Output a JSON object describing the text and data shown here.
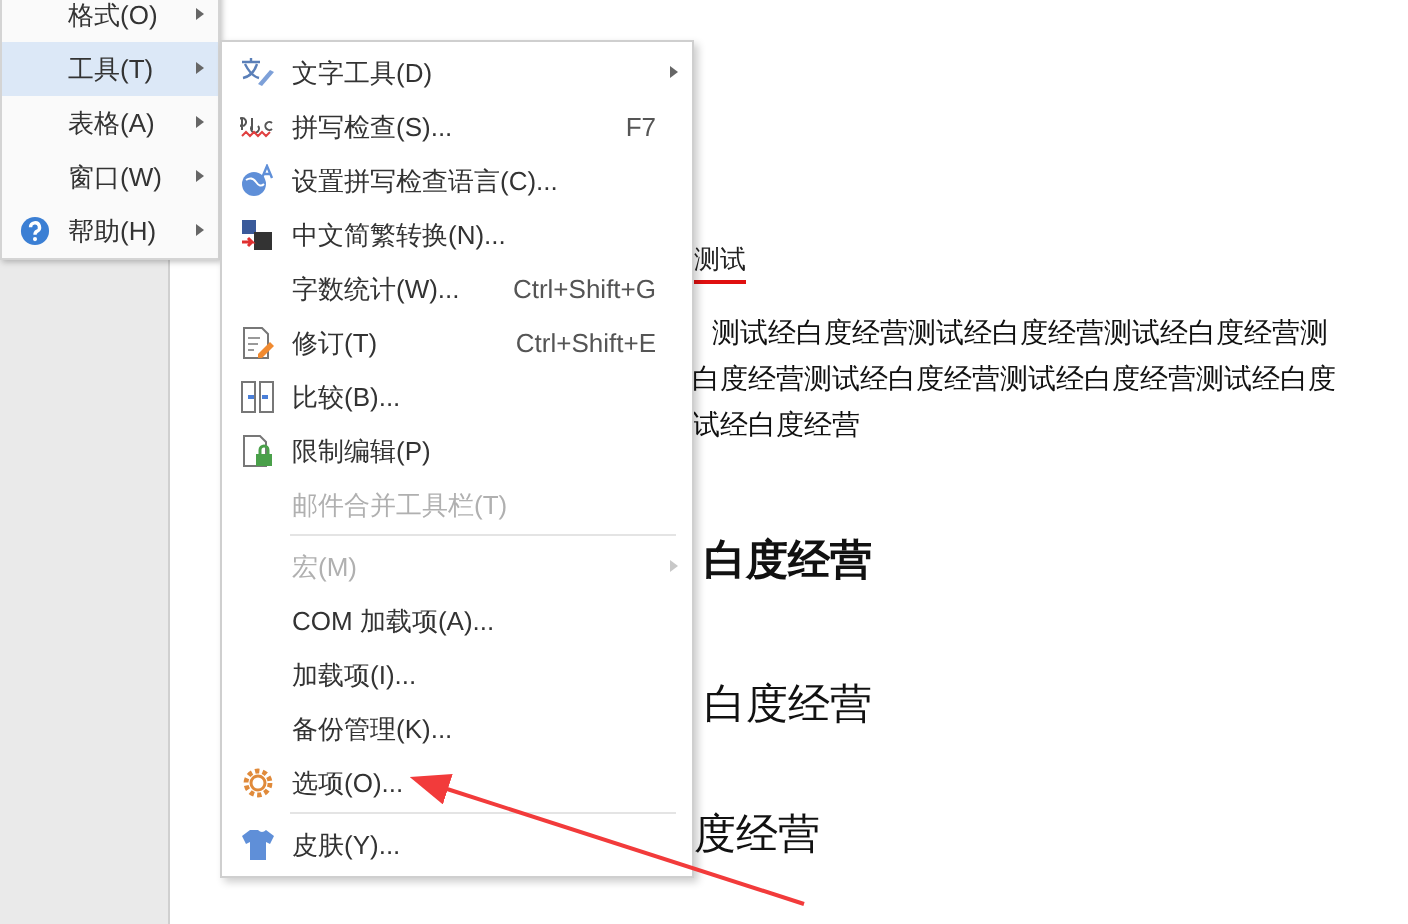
{
  "main_menu": {
    "items": [
      {
        "label": "格式(O)",
        "selected": false,
        "has_submenu": true
      },
      {
        "label": "工具(T)",
        "selected": true,
        "has_submenu": true
      },
      {
        "label": "表格(A)",
        "selected": false,
        "has_submenu": true
      },
      {
        "label": "窗口(W)",
        "selected": false,
        "has_submenu": true
      },
      {
        "label": "帮助(H)",
        "selected": false,
        "has_submenu": true
      }
    ]
  },
  "submenu": {
    "items": [
      {
        "kind": "item",
        "label": "文字工具(D)",
        "disabled": false,
        "has_submenu": true
      },
      {
        "kind": "item",
        "label": "拼写检查(S)...",
        "shortcut": "F7",
        "disabled": false,
        "has_submenu": false
      },
      {
        "kind": "item",
        "label": "设置拼写检查语言(C)...",
        "disabled": false,
        "has_submenu": false
      },
      {
        "kind": "item",
        "label": "中文简繁转换(N)...",
        "disabled": false,
        "has_submenu": false
      },
      {
        "kind": "item",
        "label": "字数统计(W)...",
        "shortcut": "Ctrl+Shift+G",
        "disabled": false,
        "has_submenu": false
      },
      {
        "kind": "item",
        "label": "修订(T)",
        "shortcut": "Ctrl+Shift+E",
        "disabled": false,
        "has_submenu": false
      },
      {
        "kind": "item",
        "label": "比较(B)...",
        "disabled": false,
        "has_submenu": false
      },
      {
        "kind": "item",
        "label": "限制编辑(P)",
        "disabled": false,
        "has_submenu": false
      },
      {
        "kind": "item",
        "label": "邮件合并工具栏(T)",
        "disabled": true,
        "has_submenu": false
      },
      {
        "kind": "separator"
      },
      {
        "kind": "item",
        "label": "宏(M)",
        "disabled": true,
        "has_submenu": true
      },
      {
        "kind": "item",
        "label": "COM 加载项(A)...",
        "disabled": false,
        "has_submenu": false
      },
      {
        "kind": "item",
        "label": "加载项(I)...",
        "disabled": false,
        "has_submenu": false
      },
      {
        "kind": "item",
        "label": "备份管理(K)...",
        "disabled": false,
        "has_submenu": false
      },
      {
        "kind": "item",
        "label": "选项(O)...",
        "disabled": false,
        "has_submenu": false
      },
      {
        "kind": "separator"
      },
      {
        "kind": "item",
        "label": "皮肤(Y)...",
        "disabled": false,
        "has_submenu": false
      }
    ]
  },
  "document": {
    "title": "测试",
    "paragraph_lines": [
      "测试经白度经营测试经白度经营测试经白度经营测",
      "白度经营测试经白度经营测试经白度经营测试经白度",
      "试经白度经营"
    ],
    "headings": [
      {
        "text": "白度经营",
        "bold": true
      },
      {
        "text": "白度经营",
        "bold": false
      },
      {
        "text": "度经营",
        "bold": false
      }
    ]
  }
}
